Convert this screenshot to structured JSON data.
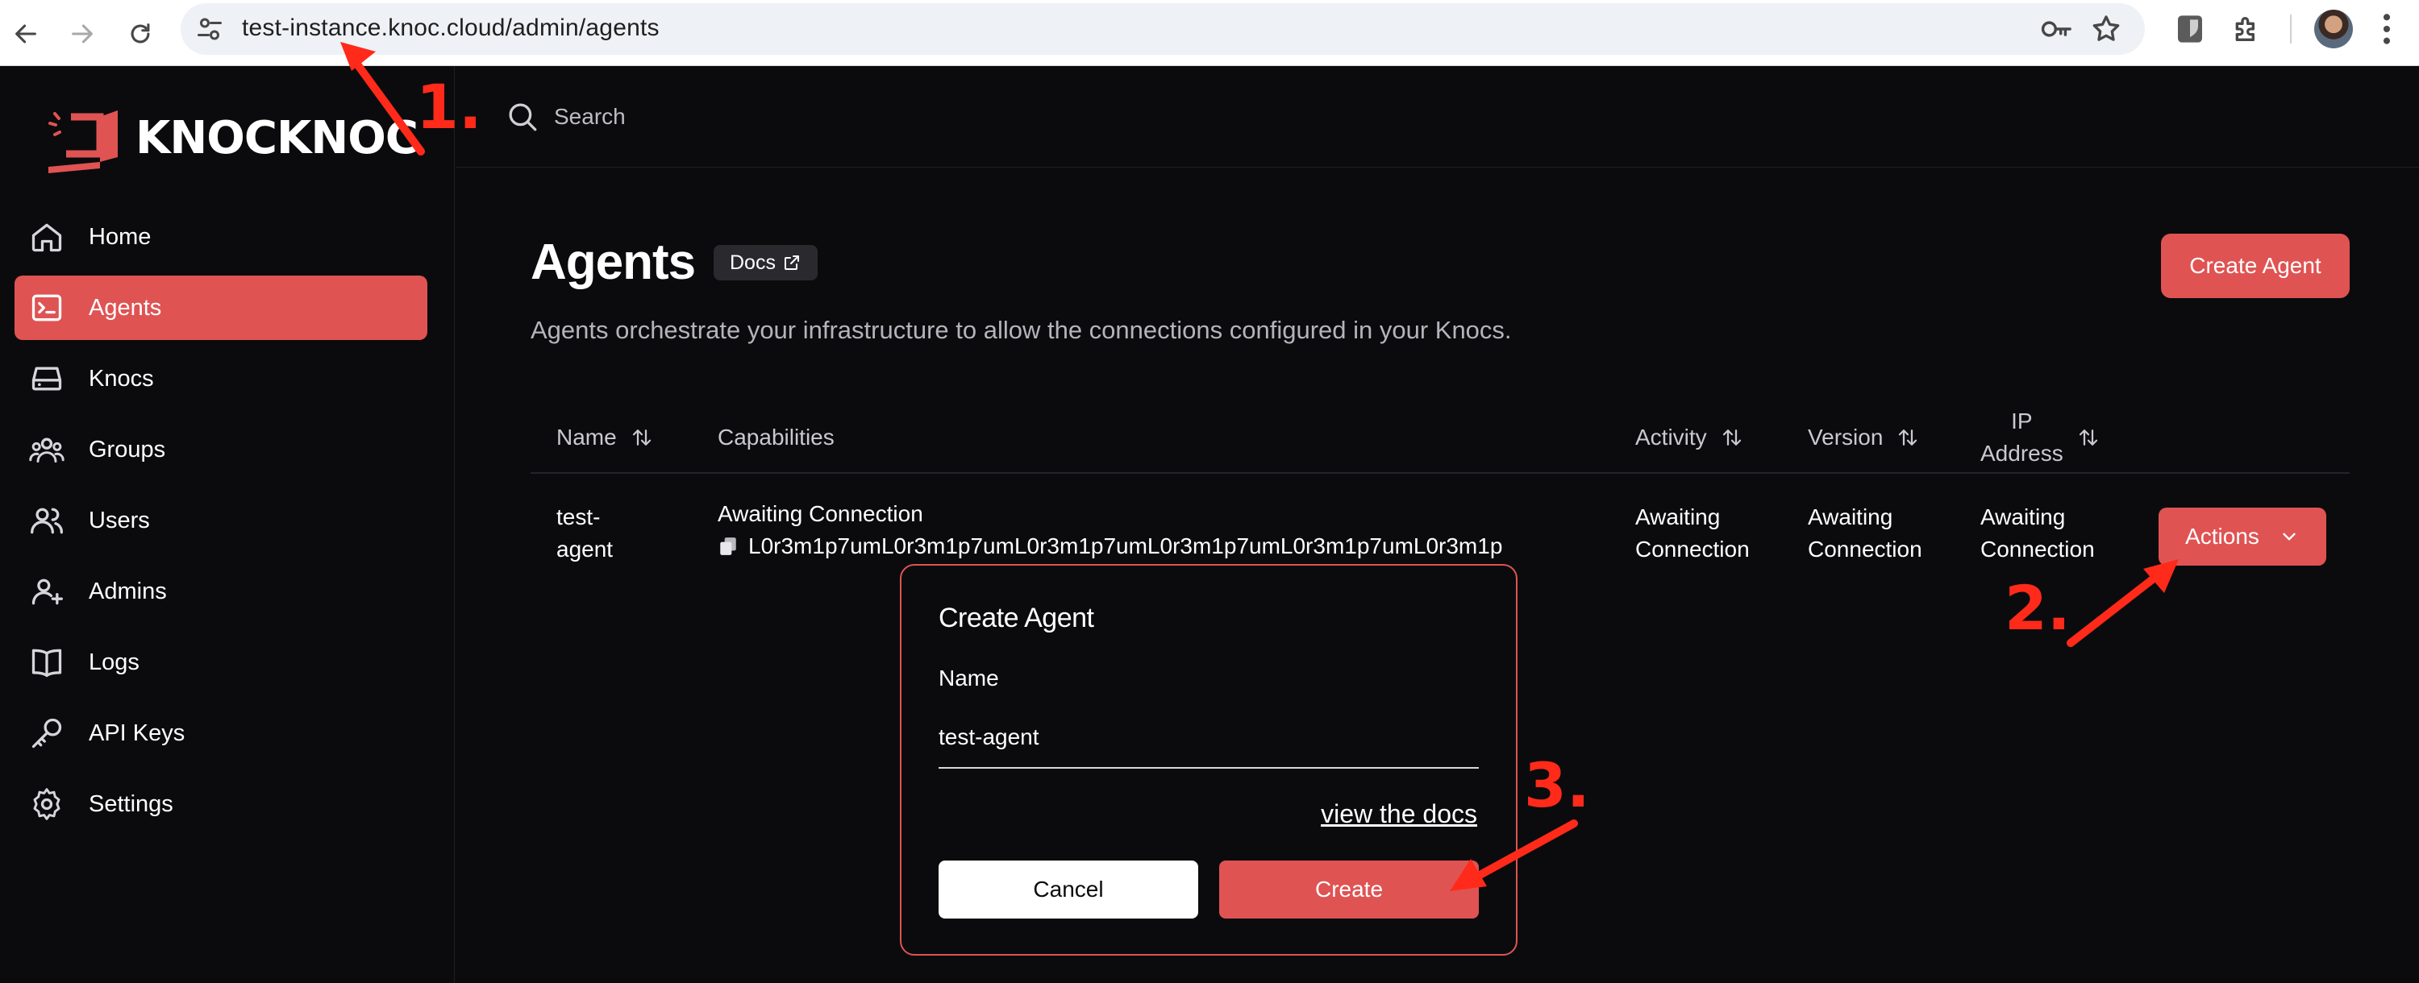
{
  "browser": {
    "url": "test-instance.knoc.cloud/admin/agents",
    "icons": [
      "back-arrow-icon",
      "forward-arrow-icon",
      "reload-icon",
      "site-settings-icon",
      "password-key-icon",
      "bookmark-star-icon",
      "bitwarden-extension-icon",
      "extensions-puzzle-icon",
      "profile-avatar",
      "more-menu-icon"
    ]
  },
  "brand": {
    "name": "KNOCKNOC",
    "accent_color": "#e05353"
  },
  "search": {
    "placeholder": "Search"
  },
  "sidebar": {
    "items": [
      {
        "label": "Home",
        "icon": "home-icon",
        "active": false
      },
      {
        "label": "Agents",
        "icon": "terminal-icon",
        "active": true
      },
      {
        "label": "Knocs",
        "icon": "hard-drive-icon",
        "active": false
      },
      {
        "label": "Groups",
        "icon": "groups-icon",
        "active": false
      },
      {
        "label": "Users",
        "icon": "users-icon",
        "active": false
      },
      {
        "label": "Admins",
        "icon": "user-plus-icon",
        "active": false
      },
      {
        "label": "Logs",
        "icon": "book-icon",
        "active": false
      },
      {
        "label": "API Keys",
        "icon": "key-icon",
        "active": false
      },
      {
        "label": "Settings",
        "icon": "gear-icon",
        "active": false
      }
    ]
  },
  "page": {
    "title": "Agents",
    "docs_label": "Docs",
    "subtitle": "Agents orchestrate your infrastructure to allow the connections configured in your Knocs.",
    "create_button": "Create Agent"
  },
  "table": {
    "columns": {
      "name": "Name",
      "capabilities": "Capabilities",
      "activity": "Activity",
      "version": "Version",
      "ip_line1": "IP",
      "ip_line2": "Address"
    },
    "rows": [
      {
        "name_line1": "test-",
        "name_line2": "agent",
        "capability_status": "Awaiting Connection",
        "capability_id": "L0r3m1p7umL0r3m1p7umL0r3m1p7umL0r3m1p7umL0r3m1p7umL0r3m1p",
        "activity_line1": "Awaiting",
        "activity_line2": "Connection",
        "version_line1": "Awaiting",
        "version_line2": "Connection",
        "ip_line1": "Awaiting",
        "ip_line2": "Connection",
        "actions_label": "Actions"
      }
    ]
  },
  "modal": {
    "title": "Create Agent",
    "name_label": "Name",
    "name_value": "test-agent",
    "docs_link": "view the docs",
    "cancel_label": "Cancel",
    "create_label": "Create"
  },
  "annotations": {
    "step1": "1.",
    "step2": "2.",
    "step3": "3.",
    "color": "#ff2a1a"
  }
}
